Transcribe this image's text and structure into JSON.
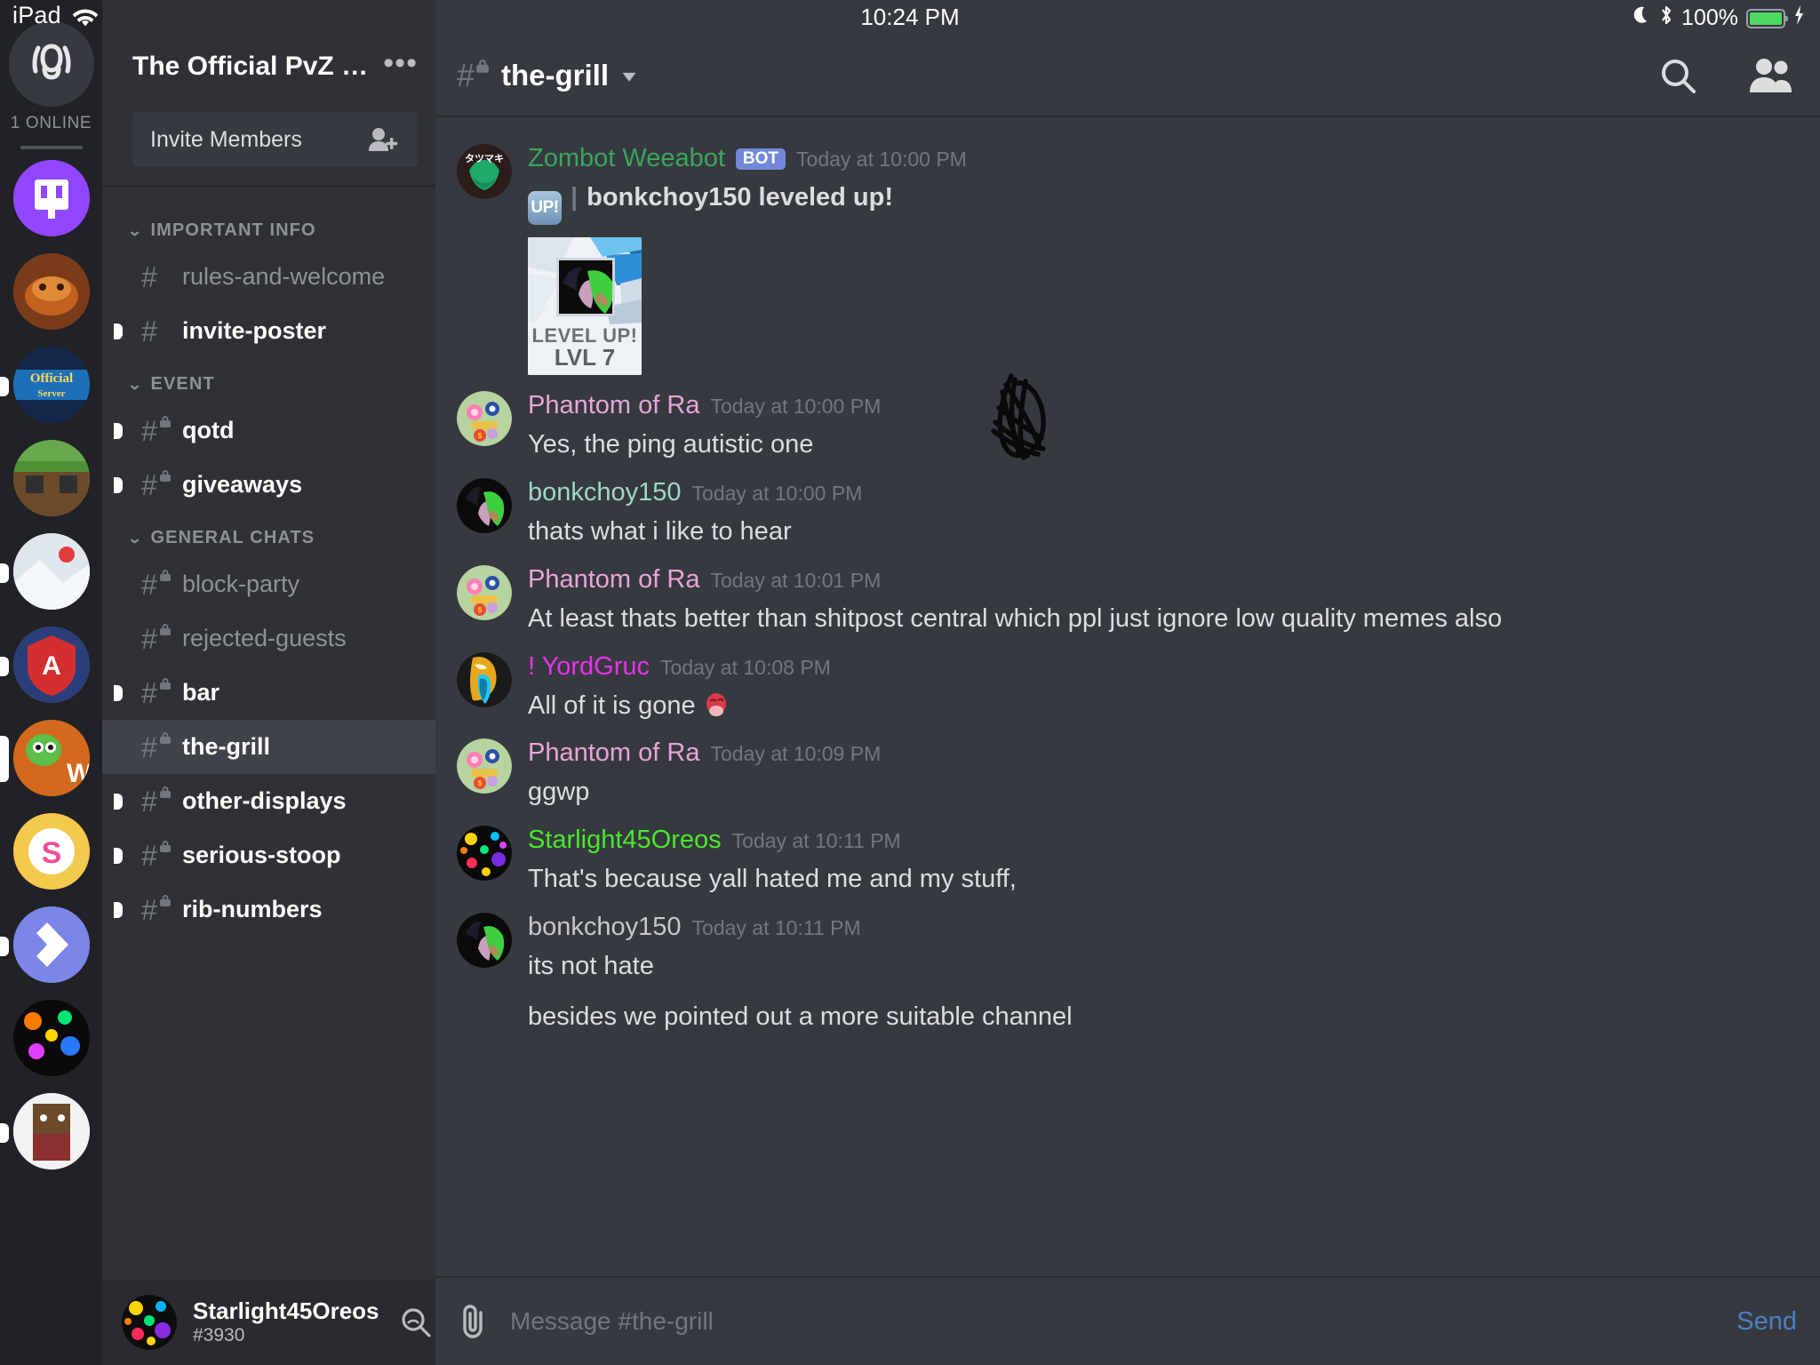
{
  "status_bar": {
    "device": "iPad",
    "wifi_icon": "wifi-icon",
    "time": "10:24 PM",
    "moon_icon": "moon-icon",
    "bluetooth_icon": "bluetooth-icon",
    "battery_percent": "100%",
    "charging_icon": "charging-bolt-icon"
  },
  "guild_rail": {
    "home_icon": "discord-home-icon",
    "online_label": "1 ONLINE",
    "servers": [
      {
        "name": "twitch-server",
        "color": "#9b4dff",
        "unread": false,
        "selected": false
      },
      {
        "name": "brown-server",
        "color": "#8a4a22",
        "unread": false,
        "selected": false
      },
      {
        "name": "official-server",
        "color": "#1e3c6e",
        "unread": true,
        "selected": false
      },
      {
        "name": "minecraft-server",
        "color": "#4a7a3a",
        "unread": false,
        "selected": false
      },
      {
        "name": "snow-server",
        "color": "#d8dde3",
        "unread": true,
        "selected": false
      },
      {
        "name": "red-a-server",
        "color": "#c62828",
        "unread": true,
        "selected": false
      },
      {
        "name": "pvz-wiki-server",
        "color": "#d2691e",
        "unread": false,
        "selected": true
      },
      {
        "name": "pink-s-server",
        "color": "#ef4d9a",
        "unread": false,
        "selected": false
      },
      {
        "name": "blue-diamond-server",
        "color": "#7b86e8",
        "unread": true,
        "selected": false
      },
      {
        "name": "rainbow-server",
        "color": "#101010",
        "unread": false,
        "selected": false
      },
      {
        "name": "white-server",
        "color": "#f2f2f2",
        "unread": true,
        "selected": false
      }
    ]
  },
  "sidebar": {
    "guild_title": "The Official PvZ Wiki Di...",
    "more_icon": "more-options-icon",
    "invite_label": "Invite Members",
    "invite_icon": "add-person-icon",
    "categories": [
      {
        "label": "IMPORTANT INFO",
        "channels": [
          {
            "name": "rules-and-welcome",
            "locked": false,
            "unread": false,
            "active": false
          },
          {
            "name": "invite-poster",
            "locked": false,
            "unread": true,
            "active": false
          }
        ]
      },
      {
        "label": "EVENT",
        "channels": [
          {
            "name": "qotd",
            "locked": true,
            "unread": true,
            "active": false
          },
          {
            "name": "giveaways",
            "locked": true,
            "unread": true,
            "active": false
          }
        ]
      },
      {
        "label": "GENERAL CHATS",
        "channels": [
          {
            "name": "block-party",
            "locked": true,
            "unread": false,
            "active": false
          },
          {
            "name": "rejected-guests",
            "locked": true,
            "unread": false,
            "active": false
          },
          {
            "name": "bar",
            "locked": true,
            "unread": true,
            "active": false
          },
          {
            "name": "the-grill",
            "locked": true,
            "unread": false,
            "active": true
          },
          {
            "name": "other-displays",
            "locked": true,
            "unread": true,
            "active": false
          },
          {
            "name": "serious-stoop",
            "locked": true,
            "unread": true,
            "active": false
          },
          {
            "name": "rib-numbers",
            "locked": true,
            "unread": true,
            "active": false
          }
        ]
      }
    ],
    "user": {
      "name": "Starlight45Oreos",
      "discriminator": "#3930",
      "search_icon": "user-search-icon",
      "mentions_icon": "at-mentions-icon",
      "settings_icon": "gear-icon"
    }
  },
  "channel_header": {
    "hash_icon": "hash-locked-icon",
    "name": "the-grill",
    "caret_icon": "chevron-down-icon",
    "search_icon": "search-icon",
    "members_icon": "members-icon"
  },
  "messages": [
    {
      "author": "Zombot Weeabot",
      "author_color": "#3ba55c",
      "bot": true,
      "bot_label": "BOT",
      "timestamp": "Today at 10:00 PM",
      "emoji": "UP!",
      "text": "bonkchoy150 leveled up!",
      "bold": true,
      "attachment": {
        "title": "LEVEL UP!",
        "level": "LVL 7"
      },
      "avatar": "zombot-weeabot-avatar"
    },
    {
      "author": "Phantom of Ra",
      "author_color": "#e8a6d8",
      "bot": false,
      "timestamp": "Today at 10:00 PM",
      "text": "Yes, the ping autistic one",
      "avatar": "phantom-of-ra-avatar"
    },
    {
      "author": "bonkchoy150",
      "author_color": "#9fd8c8",
      "bot": false,
      "timestamp": "Today at 10:00 PM",
      "text": "thats what i like to hear",
      "avatar": "bonkchoy150-avatar"
    },
    {
      "author": "Phantom of Ra",
      "author_color": "#e8a6d8",
      "bot": false,
      "timestamp": "Today at 10:01 PM",
      "text": "At least thats better than shitpost central which ppl just ignore low quality memes also",
      "avatar": "phantom-of-ra-avatar"
    },
    {
      "author": "! YordGruc",
      "author_color": "#e832e8",
      "bot": false,
      "timestamp": "Today at 10:08 PM",
      "text": "All of it is gone",
      "trailing_emoji": "pepe-sad-emoji",
      "avatar": "yordgruc-avatar"
    },
    {
      "author": "Phantom of Ra",
      "author_color": "#e8a6d8",
      "bot": false,
      "timestamp": "Today at 10:09 PM",
      "text": "ggwp",
      "avatar": "phantom-of-ra-avatar"
    },
    {
      "author": "Starlight45Oreos",
      "author_color": "#4ae82e",
      "bot": false,
      "timestamp": "Today at 10:11 PM",
      "text": "That's because yall hated me and my stuff,",
      "avatar": "starlight45oreos-avatar"
    },
    {
      "author": "bonkchoy150",
      "author_color": "#c8c8c8",
      "bot": false,
      "timestamp": "Today at 10:11 PM",
      "text": "its not hate",
      "text2": "besides we pointed out a more suitable channel",
      "avatar": "bonkchoy150-avatar"
    }
  ],
  "composer": {
    "attach_icon": "attachment-clip-icon",
    "placeholder": "Message #the-grill",
    "send_label": "Send"
  },
  "colors": {
    "rail_bg": "#202225",
    "sidebar_bg": "#2f3136",
    "chat_bg": "#36393f",
    "active_channel_bg": "#3f4248",
    "bot_tag": "#7289da",
    "send_blue": "#4b7fc4",
    "battery_green": "#4cd964"
  }
}
